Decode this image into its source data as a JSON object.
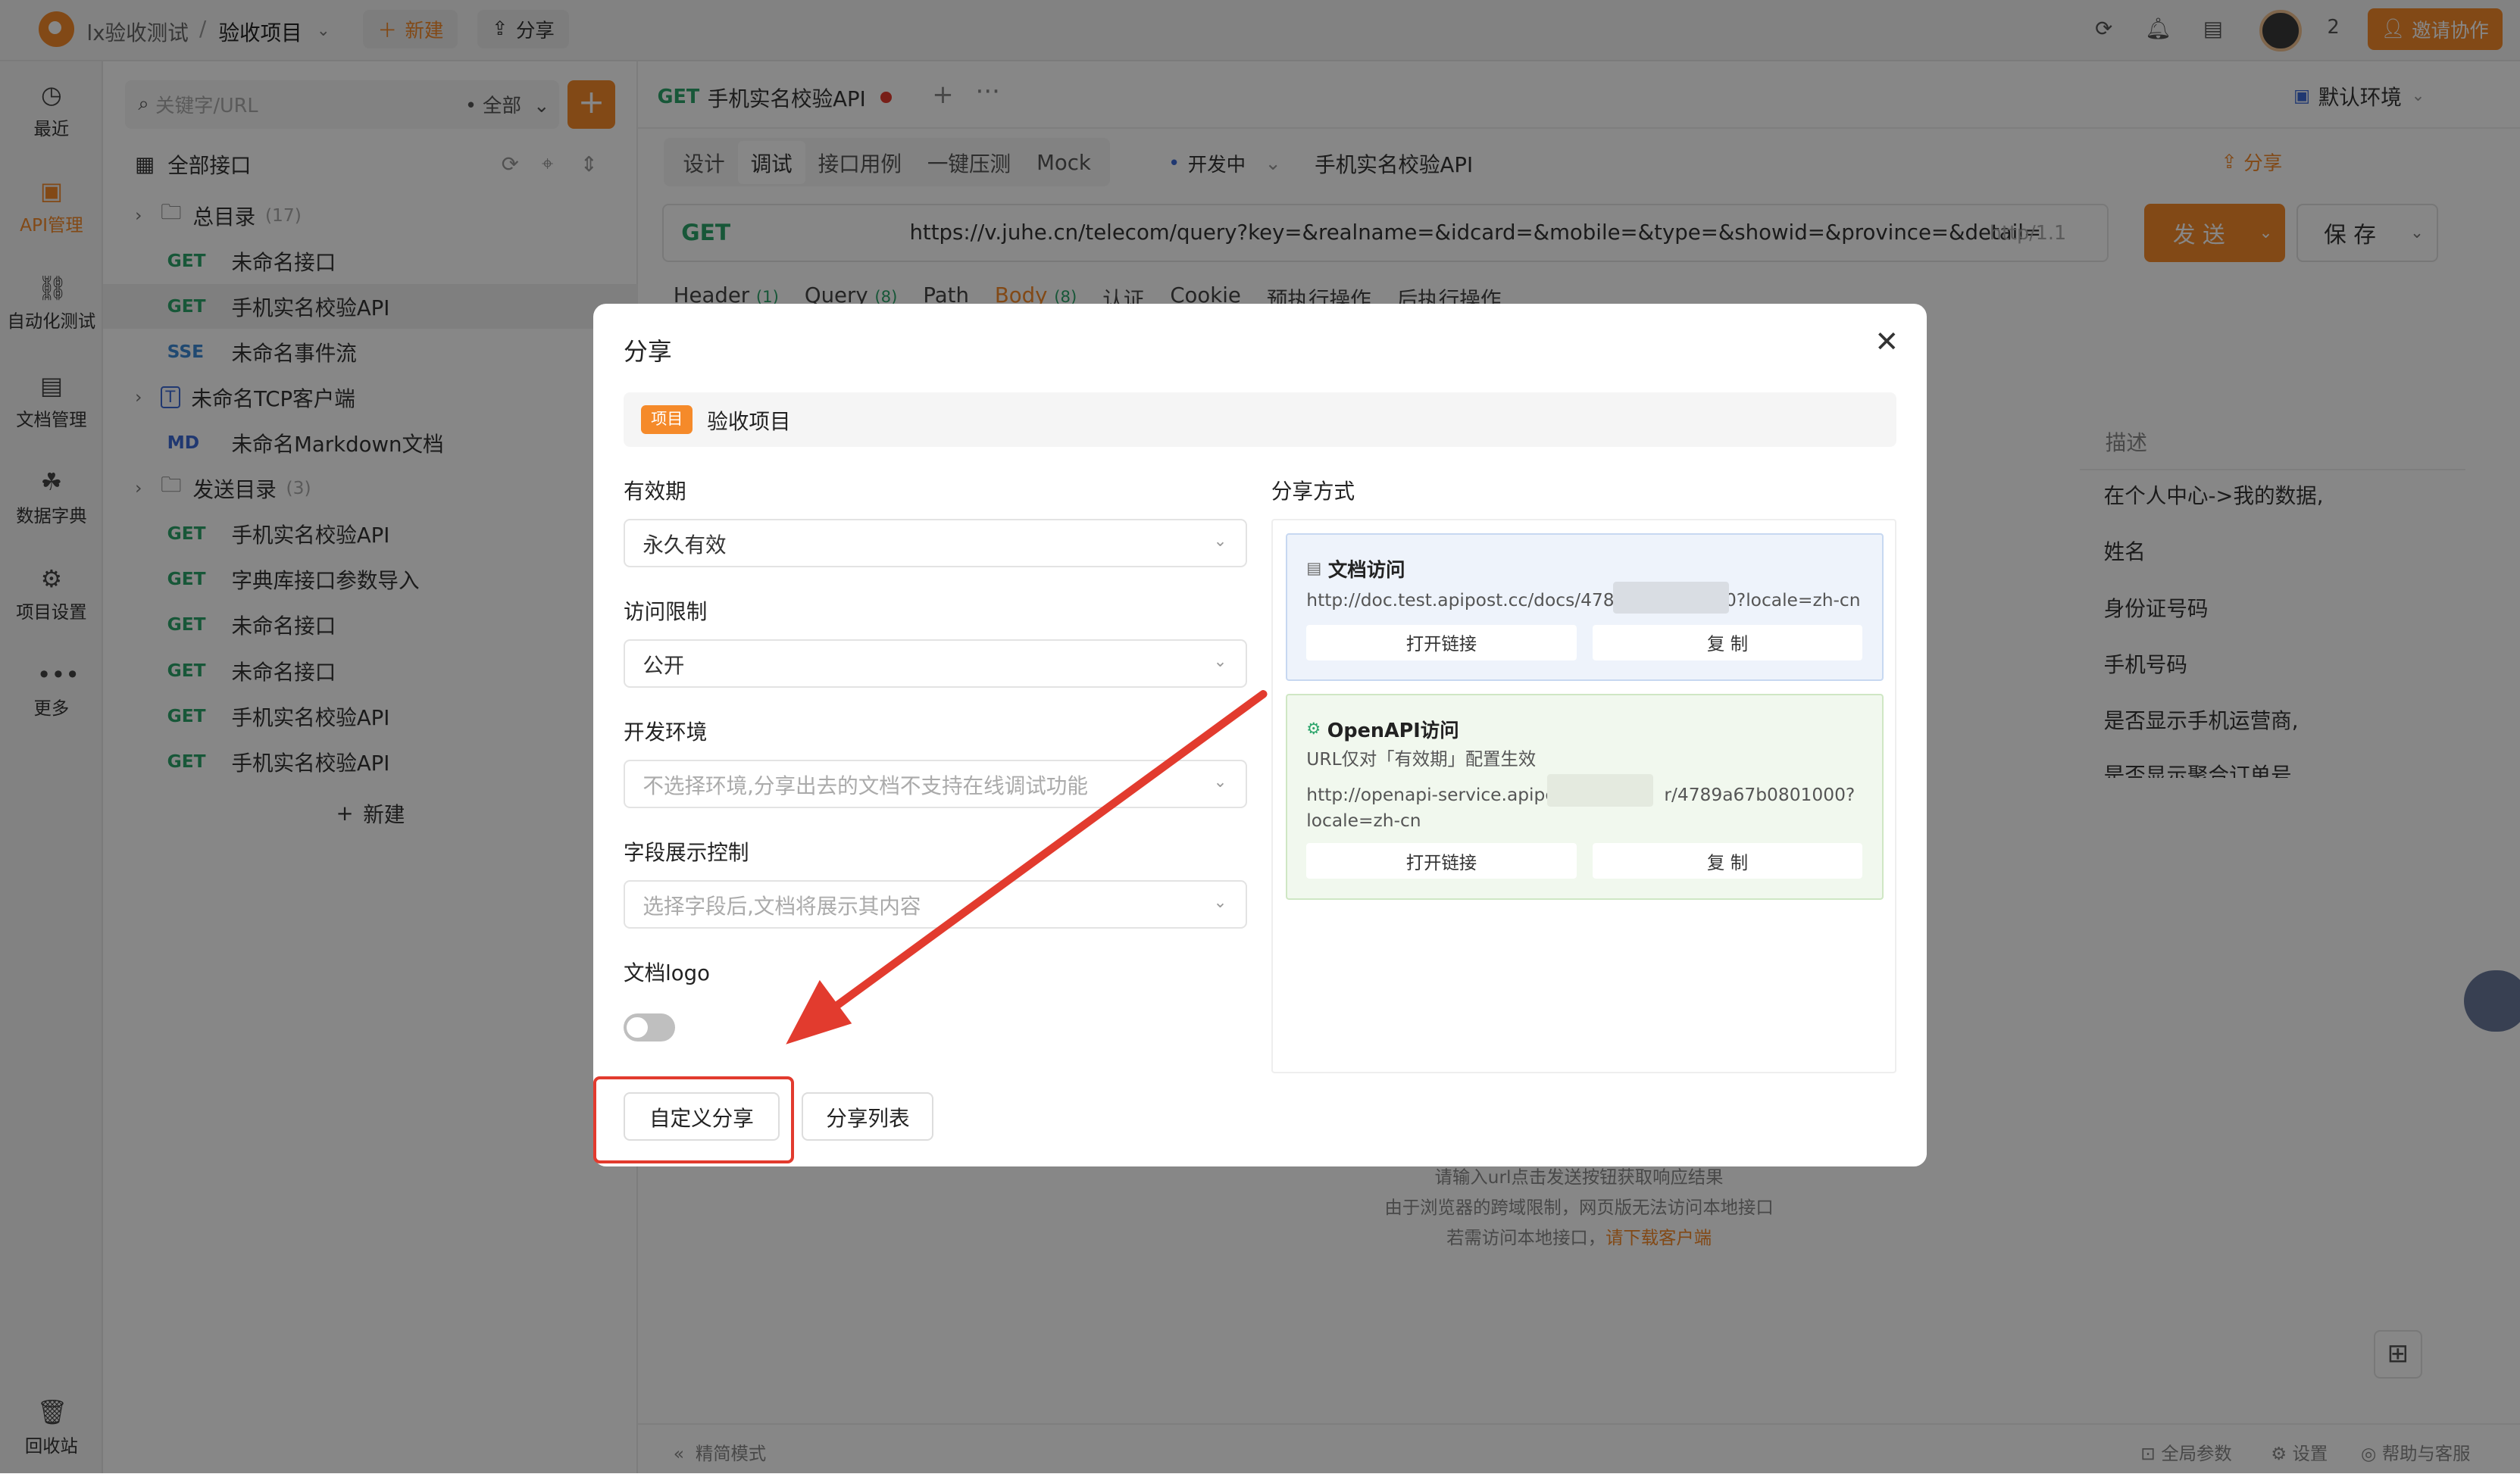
{
  "topbar": {
    "team": "lx验收测试",
    "separator": "/",
    "project": "验收项目",
    "new_label": "新建",
    "share_label": "分享",
    "member_count": "2",
    "invite_label": "邀请协作"
  },
  "leftnav": {
    "items": [
      {
        "label": "最近",
        "icon": "clock-icon"
      },
      {
        "label": "API管理",
        "icon": "api-icon"
      },
      {
        "label": "自动化测试",
        "icon": "flow-icon"
      },
      {
        "label": "文档管理",
        "icon": "doc-icon"
      },
      {
        "label": "数据字典",
        "icon": "dict-icon"
      },
      {
        "label": "项目设置",
        "icon": "settings-icon"
      },
      {
        "label": "更多",
        "icon": "more-icon"
      }
    ],
    "recycle": "回收站"
  },
  "tree": {
    "search_placeholder": "关键字/URL",
    "filter": "全部",
    "all_label": "全部接口",
    "new_label": "新建",
    "rows": [
      {
        "type": "folder",
        "name": "总目录",
        "count": "(17)"
      },
      {
        "type": "api",
        "method": "GET",
        "name": "未命名接口"
      },
      {
        "type": "api",
        "method": "GET",
        "name": "手机实名校验API"
      },
      {
        "type": "api",
        "method": "SSE",
        "name": "未命名事件流"
      },
      {
        "type": "tcp",
        "method": "T",
        "name": "未命名TCP客户端"
      },
      {
        "type": "api",
        "method": "MD",
        "name": "未命名Markdown文档"
      },
      {
        "type": "folder",
        "name": "发送目录",
        "count": "(3)"
      },
      {
        "type": "api",
        "method": "GET",
        "name": "手机实名校验API"
      },
      {
        "type": "api",
        "method": "GET",
        "name": "字典库接口参数导入"
      },
      {
        "type": "api",
        "method": "GET",
        "name": "未命名接口"
      },
      {
        "type": "api",
        "method": "GET",
        "name": "未命名接口"
      },
      {
        "type": "api",
        "method": "GET",
        "name": "手机实名校验API"
      },
      {
        "type": "api",
        "method": "GET",
        "name": "手机实名校验API"
      }
    ]
  },
  "main": {
    "tab_method": "GET",
    "tab_title": "手机实名校验API",
    "env_label": "默认环境",
    "subtabs": [
      "设计",
      "调试",
      "接口用例",
      "一键压测",
      "Mock"
    ],
    "status": "开发中",
    "api_name": "手机实名校验API",
    "share_label": "分享",
    "method": "GET",
    "url": "https://v.juhe.cn/telecom/query?key=&realname=&idcard=&mobile=&type=&showid=&province=&detail=",
    "protocol": "http/1.1",
    "send_label": "发 送",
    "save_label": "保 存",
    "param_tabs": [
      {
        "name": "Header",
        "count": "(1)"
      },
      {
        "name": "Query",
        "count": "(8)"
      },
      {
        "name": "Path",
        "count": ""
      },
      {
        "name": "Body",
        "count": "(8)"
      },
      {
        "name": "认证",
        "count": ""
      },
      {
        "name": "Cookie",
        "count": ""
      },
      {
        "name": "预执行操作",
        "count": ""
      },
      {
        "name": "后执行操作",
        "count": ""
      }
    ],
    "desc_header": "描述",
    "desc_rows": [
      "在个人中心->我的数据,",
      "姓名",
      "身份证号码",
      "手机号码",
      "是否显示手机运营商,",
      "是否显示聚合订单号"
    ],
    "hint_lines": [
      "请输入url点击发送按钮获取响应结果",
      "由于浏览器的跨域限制，网页版无法访问本地接口"
    ],
    "hint_line3_prefix": "若需访问本地接口，",
    "hint_download": "请下载客户端"
  },
  "footer": {
    "simple_mode": "精简模式",
    "global_params": "全局参数",
    "settings": "设置",
    "help": "帮助与客服"
  },
  "modal": {
    "title": "分享",
    "project_tag": "项目",
    "project_name": "验收项目",
    "validity_label": "有效期",
    "validity_value": "永久有效",
    "access_label": "访问限制",
    "access_value": "公开",
    "env_label": "开发环境",
    "env_placeholder": "不选择环境,分享出去的文档不支持在线调试功能",
    "field_label": "字段展示控制",
    "field_placeholder": "选择字段后,文档将展示其内容",
    "logo_label": "文档logo",
    "logo_enabled": false,
    "custom_share": "自定义分享",
    "share_list": "分享列表",
    "share_method_label": "分享方式",
    "doc_card": {
      "title": "文档访问",
      "url_start": "http://doc.test.apipost.cc/docs/4789",
      "url_end": "0?locale=zh-cn",
      "open": "打开链接",
      "copy": "复 制"
    },
    "openapi_card": {
      "title": "OpenAPI访问",
      "note": "URL仅对「有效期」配置生效",
      "url_start": "http://openapi-service.apipc",
      "url_end": "r/4789a67b0801000?",
      "url_line2": "locale=zh-cn",
      "open": "打开链接",
      "copy": "复 制"
    }
  },
  "colors": {
    "accent": "#f58a2a",
    "highlight": "#e23b2e",
    "get": "#2ca56b"
  }
}
